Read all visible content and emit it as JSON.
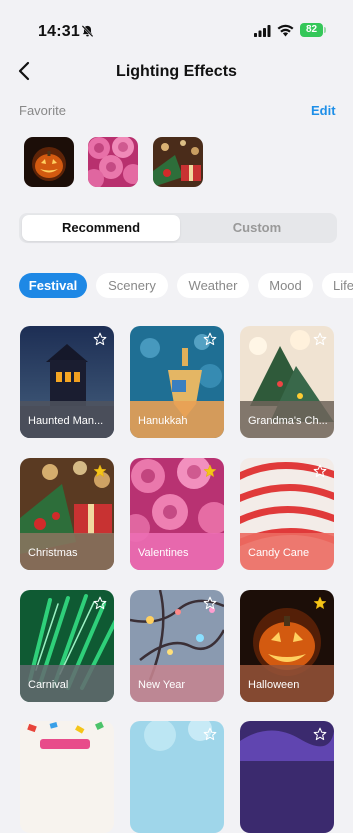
{
  "status": {
    "time": "14:31",
    "battery": "82"
  },
  "nav": {
    "title": "Lighting Effects"
  },
  "favorite": {
    "label": "Favorite",
    "edit": "Edit"
  },
  "segment": {
    "active": "Recommend",
    "inactive": "Custom"
  },
  "categories": [
    "Festival",
    "Scenery",
    "Weather",
    "Mood",
    "Life"
  ],
  "effects": [
    {
      "label": "Haunted Man...",
      "starred": false
    },
    {
      "label": "Hanukkah",
      "starred": false
    },
    {
      "label": "Grandma's Ch...",
      "starred": false
    },
    {
      "label": "Christmas",
      "starred": true
    },
    {
      "label": "Valentines",
      "starred": true
    },
    {
      "label": "Candy Cane",
      "starred": false
    },
    {
      "label": "Carnival",
      "starred": false
    },
    {
      "label": "New Year",
      "starred": false
    },
    {
      "label": "Halloween",
      "starred": true
    }
  ],
  "colors": {
    "accent": "#1e88e5",
    "link": "#1e8fe8",
    "star_filled": "#f5c518"
  }
}
